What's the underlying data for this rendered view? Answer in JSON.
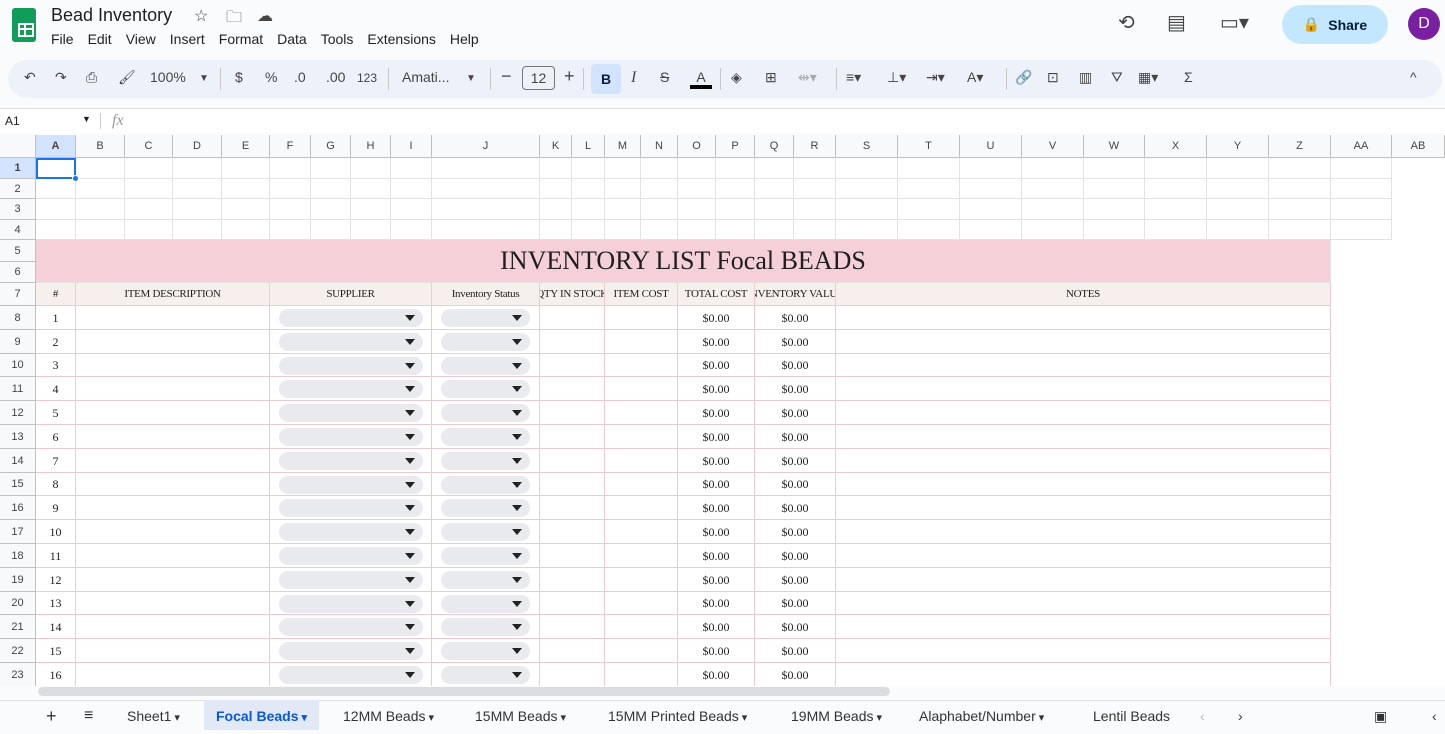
{
  "app": {
    "title": "Bead Inventory",
    "menus": [
      "File",
      "Edit",
      "View",
      "Insert",
      "Format",
      "Data",
      "Tools",
      "Extensions",
      "Help"
    ],
    "share_label": "Share",
    "avatar_initial": "D"
  },
  "toolbar": {
    "zoom": "100%",
    "currency": "$",
    "percent": "%",
    "dec_dec": ".0",
    "inc_dec": ".00",
    "format_123": "123",
    "font": "Amati...",
    "font_size": "12",
    "bold": "B",
    "italic": "I"
  },
  "formula_bar": {
    "cell_ref": "A1",
    "fx": "fx",
    "value": ""
  },
  "columns": [
    "A",
    "B",
    "C",
    "D",
    "E",
    "F",
    "G",
    "H",
    "I",
    "J",
    "K",
    "L",
    "M",
    "N",
    "O",
    "P",
    "Q",
    "R",
    "S",
    "T",
    "U",
    "V",
    "W",
    "X",
    "Y",
    "Z",
    "AA",
    "AB"
  ],
  "sheet": {
    "title": "INVENTORY LIST Focal BEADS",
    "headers": [
      "#",
      "ITEM DESCRIPTION",
      "SUPPLIER",
      "Inventory Status",
      "QTY IN STOCK",
      "ITEM COST",
      "TOTAL COST",
      "INVENTORY VALUE",
      "NOTES"
    ],
    "items": [
      {
        "n": "1",
        "total": "$0.00",
        "value": "$0.00"
      },
      {
        "n": "2",
        "total": "$0.00",
        "value": "$0.00"
      },
      {
        "n": "3",
        "total": "$0.00",
        "value": "$0.00"
      },
      {
        "n": "4",
        "total": "$0.00",
        "value": "$0.00"
      },
      {
        "n": "5",
        "total": "$0.00",
        "value": "$0.00"
      },
      {
        "n": "6",
        "total": "$0.00",
        "value": "$0.00"
      },
      {
        "n": "7",
        "total": "$0.00",
        "value": "$0.00"
      },
      {
        "n": "8",
        "total": "$0.00",
        "value": "$0.00"
      },
      {
        "n": "9",
        "total": "$0.00",
        "value": "$0.00"
      },
      {
        "n": "10",
        "total": "$0.00",
        "value": "$0.00"
      },
      {
        "n": "11",
        "total": "$0.00",
        "value": "$0.00"
      },
      {
        "n": "12",
        "total": "$0.00",
        "value": "$0.00"
      },
      {
        "n": "13",
        "total": "$0.00",
        "value": "$0.00"
      },
      {
        "n": "14",
        "total": "$0.00",
        "value": "$0.00"
      },
      {
        "n": "15",
        "total": "$0.00",
        "value": "$0.00"
      },
      {
        "n": "16",
        "total": "$0.00",
        "value": "$0.00"
      }
    ]
  },
  "tabs": [
    {
      "label": "Sheet1"
    },
    {
      "label": "Focal Beads",
      "active": true
    },
    {
      "label": "12MM Beads"
    },
    {
      "label": "15MM Beads"
    },
    {
      "label": "15MM Printed Beads"
    },
    {
      "label": "19MM Beads"
    },
    {
      "label": "Alaphabet/Number"
    },
    {
      "label": "Lentil Beads"
    }
  ],
  "colors": {
    "band": "#f5d0d8",
    "header": "#f7efec",
    "accent": "#0b57d0"
  }
}
